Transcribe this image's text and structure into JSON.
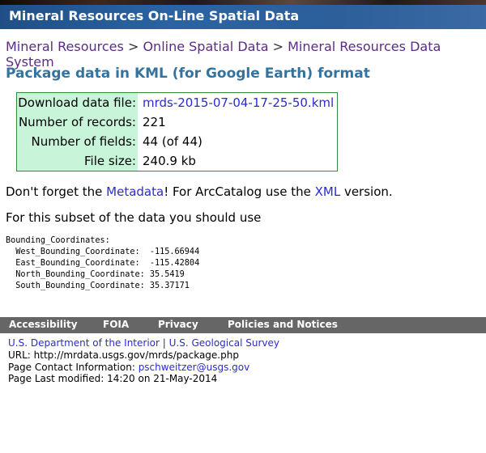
{
  "banner": {
    "title": "Mineral Resources On-Line Spatial Data"
  },
  "breadcrumb": {
    "item1": "Mineral Resources",
    "sep1": ">",
    "item2": "Online Spatial Data",
    "sep2": ">",
    "item3": "Mineral Resources Data System"
  },
  "heading": "Package data in KML (for Google Earth) format",
  "info": {
    "download_label": "Download data file:",
    "download_value": "mrds-2015-07-04-17-25-50.kml",
    "records_label": "Number of records:",
    "records_value": "221",
    "fields_label": "Number of fields:",
    "fields_value": "44 (of 44)",
    "size_label": "File size:",
    "size_value": "240.9 kb"
  },
  "para1": {
    "before": "Don't forget the ",
    "metadata_link": "Metadata",
    "middle": "! For ArcCatalog use the ",
    "xml_link": "XML",
    "after": " version."
  },
  "para2": "For this subset of the data you should use",
  "bounding": {
    "header": "Bounding_Coordinates:",
    "west": "  West_Bounding_Coordinate:  -115.66944",
    "east": "  East_Bounding_Coordinate:  -115.42804",
    "north": "  North_Bounding_Coordinate: 35.5419",
    "south": "  South_Bounding_Coordinate: 35.37171"
  },
  "footer_nav": {
    "accessibility": "Accessibility",
    "foia": "FOIA",
    "privacy": "Privacy",
    "policies": "Policies and Notices"
  },
  "footer": {
    "doi": "U.S. Department of the Interior",
    "sep": "|",
    "usgs": "U.S. Geological Survey",
    "url_label": "URL: http://mrdata.usgs.gov/mrds/package.php",
    "contact_label": "Page Contact Information: ",
    "contact_email": "pschweitzer@usgs.gov",
    "modified": "Page Last modified: 14:20 on 21-May-2014"
  }
}
